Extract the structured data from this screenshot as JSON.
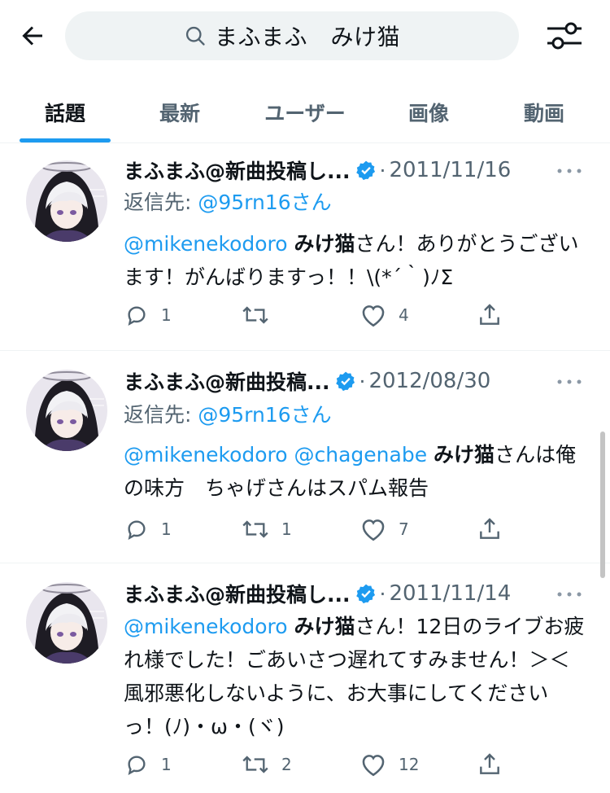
{
  "search": {
    "query": "まふまふ　みけ猫"
  },
  "tabs": [
    {
      "label": "話題"
    },
    {
      "label": "最新"
    },
    {
      "label": "ユーザー"
    },
    {
      "label": "画像"
    },
    {
      "label": "動画"
    }
  ],
  "colors": {
    "accent": "#1d9bf0",
    "secondary_text": "#536471",
    "primary_text": "#0f1419"
  },
  "tweets": [
    {
      "display_name": "まふまふ@新曲投稿し...",
      "separator": "·",
      "date": "2011/11/16",
      "reply_prefix": "返信先: ",
      "reply_handle": "@95rn16さん",
      "mentions": "@mikenekodoro",
      "highlight": "みけ猫",
      "text": "さん！ありがとうございます！がんばりますっ！！\\(*´｀)ﾉΣ",
      "replies": "1",
      "retweets": "",
      "likes": "4"
    },
    {
      "display_name": "まふまふ@新曲投稿...",
      "separator": "·",
      "date": "2012/08/30",
      "reply_prefix": "返信先: ",
      "reply_handle": "@95rn16さん",
      "mentions": "@mikenekodoro @chagenabe",
      "highlight": "みけ猫",
      "text": "さんは俺の味方　ちゃげさんはスパム報告",
      "replies": "1",
      "retweets": "1",
      "likes": "7"
    },
    {
      "display_name": "まふまふ@新曲投稿し...",
      "separator": "·",
      "date": "2011/11/14",
      "mentions": "@mikenekodoro",
      "highlight": "みけ猫",
      "text": "さん！12日のライブお疲れ様でした！ごあいさつ遅れてすみません！＞＜　風邪悪化しないように、お大事にしてくださいっ！(ﾉ)・ω・(ヾ)",
      "replies": "1",
      "retweets": "2",
      "likes": "12"
    }
  ],
  "icons": {
    "back": "arrow-left-icon",
    "search": "search-icon",
    "settings": "settings-sliders-icon",
    "verified": "verified-badge-icon",
    "more": "more-dots-icon",
    "reply": "reply-icon",
    "retweet": "retweet-icon",
    "like": "heart-icon",
    "share": "share-icon"
  }
}
